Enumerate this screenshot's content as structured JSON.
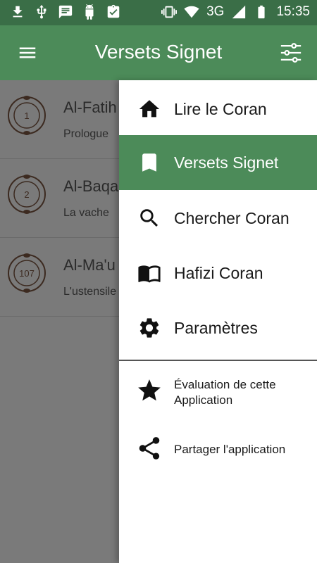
{
  "status_bar": {
    "network": "3G",
    "time": "15:35"
  },
  "app_bar": {
    "title": "Versets Signet"
  },
  "list": {
    "items": [
      {
        "number": "1",
        "name": "Al-Fatih",
        "subtitle": "Prologue"
      },
      {
        "number": "2",
        "name": "Al-Baqa",
        "subtitle": "La vache"
      },
      {
        "number": "107",
        "name": "Al-Ma'u",
        "subtitle": "L'ustensile"
      }
    ]
  },
  "drawer": {
    "items": [
      {
        "label": "Lire le Coran",
        "icon": "home-icon"
      },
      {
        "label": "Versets Signet",
        "icon": "bookmark-icon",
        "active": true
      },
      {
        "label": "Chercher Coran",
        "icon": "search-icon"
      },
      {
        "label": "Hafizi Coran",
        "icon": "book-icon"
      },
      {
        "label": "Paramètres",
        "icon": "gear-icon"
      }
    ],
    "secondary": [
      {
        "label_line1": "Évaluation de cette",
        "label_line2": "Application",
        "icon": "star-icon"
      },
      {
        "label_line1": "Partager l'application",
        "icon": "share-icon"
      }
    ]
  },
  "colors": {
    "primary": "#4c8b59",
    "status_bar": "#3a6e47",
    "scrim": "#7a7a7a"
  }
}
